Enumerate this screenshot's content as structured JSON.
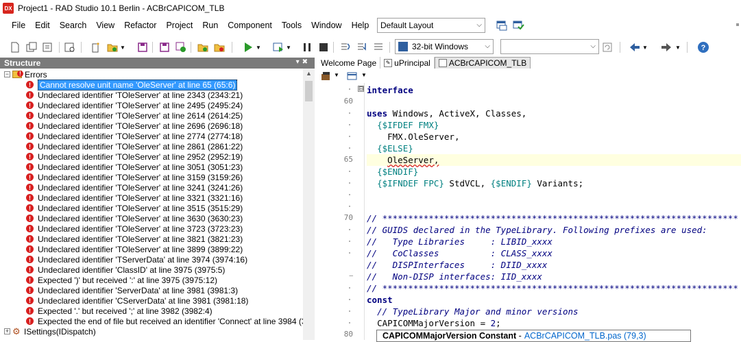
{
  "window": {
    "title": "Project1 - RAD Studio 10.1 Berlin - ACBrCAPICOM_TLB",
    "app_icon": "DX"
  },
  "menu": [
    "File",
    "Edit",
    "Search",
    "View",
    "Refactor",
    "Project",
    "Run",
    "Component",
    "Tools",
    "Window",
    "Help"
  ],
  "layout_combo": "Default Layout",
  "platform_combo": "32-bit Windows",
  "config_combo": "",
  "structure": {
    "title": "Structure",
    "root_label": "Errors",
    "errors": [
      "Cannot resolve unit name 'OleServer' at line 65 (65:6)",
      "Undeclared identifier 'TOleServer' at line 2343 (2343:21)",
      "Undeclared identifier 'TOleServer' at line 2495 (2495:24)",
      "Undeclared identifier 'TOleServer' at line 2614 (2614:25)",
      "Undeclared identifier 'TOleServer' at line 2696 (2696:18)",
      "Undeclared identifier 'TOleServer' at line 2774 (2774:18)",
      "Undeclared identifier 'TOleServer' at line 2861 (2861:22)",
      "Undeclared identifier 'TOleServer' at line 2952 (2952:19)",
      "Undeclared identifier 'TOleServer' at line 3051 (3051:23)",
      "Undeclared identifier 'TOleServer' at line 3159 (3159:26)",
      "Undeclared identifier 'TOleServer' at line 3241 (3241:26)",
      "Undeclared identifier 'TOleServer' at line 3321 (3321:16)",
      "Undeclared identifier 'TOleServer' at line 3515 (3515:29)",
      "Undeclared identifier 'TOleServer' at line 3630 (3630:23)",
      "Undeclared identifier 'TOleServer' at line 3723 (3723:23)",
      "Undeclared identifier 'TOleServer' at line 3821 (3821:23)",
      "Undeclared identifier 'TOleServer' at line 3899 (3899:22)",
      "Undeclared identifier 'TServerData' at line 3974 (3974:16)",
      "Undeclared identifier 'ClassID' at line 3975 (3975:5)",
      "Expected ')' but received ':' at line 3975 (3975:12)",
      "Undeclared identifier 'ServerData' at line 3981 (3981:3)",
      "Undeclared identifier 'CServerData' at line 3981 (3981:18)",
      "Expected '.' but received ';' at line 3982 (3982:4)",
      "Expected the end of file but received an identifier 'Connect' at line 3984 (3"
    ],
    "next_node": "ISettings(IDispatch)"
  },
  "tabs": [
    "Welcome Page",
    "uPrincipal",
    "ACBrCAPICOM_TLB"
  ],
  "gutter": {
    "line60": "60",
    "line65": "65",
    "line70": "70",
    "line80": "80"
  },
  "code": {
    "l0": "interface",
    "l1": "uses Windows, ActiveX, Classes,",
    "l2a": "{$IFDEF FMX}",
    "l3": "FMX.OleServer,",
    "l4": "{$ELSE}",
    "l5": "OleServer,",
    "l6": "{$ENDIF}",
    "l7a": "{$IFNDEF FPC}",
    "l7b": " StdVCL, ",
    "l7c": "{$ENDIF}",
    "l7d": " Variants;",
    "c1": "// *********************************************************************",
    "c2": "// GUIDS declared in the TypeLibrary. Following prefixes are used:",
    "c3": "//   Type Libraries     : LIBID_xxxx",
    "c4": "//   CoClasses          : CLASS_xxxx",
    "c5": "//   DISPInterfaces     : DIID_xxxx",
    "c6": "//   Non-DISP interfaces: IID_xxxx",
    "c7": "// *********************************************************************",
    "const": "const",
    "c8": "// TypeLibrary Major and minor versions",
    "cv_name": "CAPICOMMajorVersion = ",
    "cv_val": "2",
    "cv_end": ";"
  },
  "hint": {
    "bold": "CAPICOMMajorVersion Constant",
    "sep": "-",
    "link": "ACBrCAPICOM_TLB.pas (79,3)"
  }
}
